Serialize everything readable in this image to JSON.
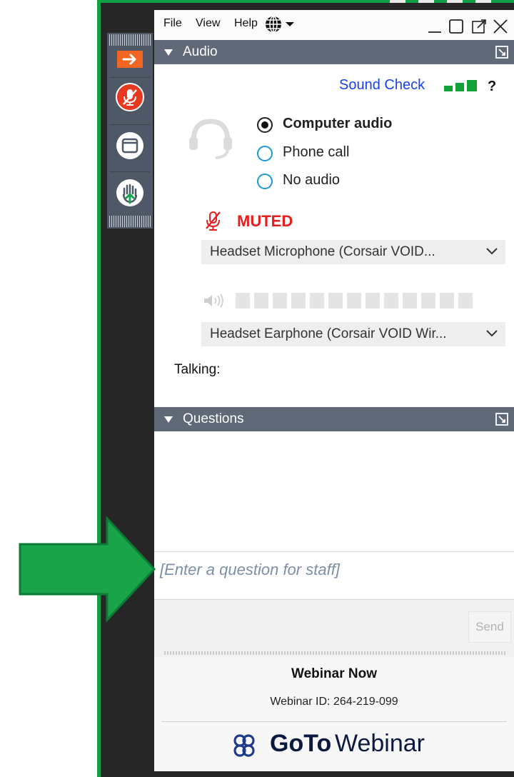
{
  "menubar": {
    "items": [
      "File",
      "View",
      "Help"
    ]
  },
  "audio": {
    "section_title": "Audio",
    "sound_check": "Sound Check",
    "help": "?",
    "options": [
      "Computer audio",
      "Phone call",
      "No audio"
    ],
    "selected_option": "Computer audio",
    "muted_label": "MUTED",
    "microphone": "Headset Microphone (Corsair VOID...",
    "speaker": "Headset Earphone (Corsair VOID Wir...",
    "talking_label": "Talking:",
    "sound_check_level": 3
  },
  "questions": {
    "section_title": "Questions",
    "input_placeholder": "[Enter a question for staff]",
    "send_label": "Send"
  },
  "footer": {
    "webinar_title": "Webinar Now",
    "webinar_id": "Webinar ID: 264-219-099",
    "brand_bold": "GoTo",
    "brand_light": "Webinar"
  },
  "colors": {
    "frame_green": "#12a046",
    "header_slate": "#5f6978",
    "link_blue": "#1a3ff0",
    "muted_red": "#e81e1e",
    "radio_blue": "#1b9ad6",
    "arrow_green": "#19a44a"
  }
}
